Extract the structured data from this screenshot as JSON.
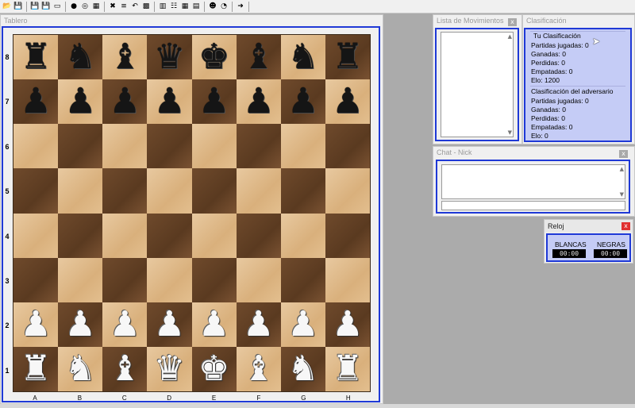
{
  "toolbar": {
    "icons": [
      "open-folder-icon",
      "save-icon",
      "save-as-icon",
      "save-all-icon",
      "board-icon",
      "globe-icon",
      "network-icon",
      "grid-icon",
      "close-x-icon",
      "stack-icon",
      "undo-icon",
      "pattern-icon",
      "bars-icon",
      "list-icon",
      "checker-icon",
      "book-icon",
      "chat-icon",
      "clock-icon",
      "exit-icon"
    ],
    "glyphs": [
      "📂",
      "💾",
      "💾",
      "💾",
      "▭",
      "●",
      "◎",
      "▦",
      "✖",
      "≡",
      "↶",
      "▩",
      "▥",
      "☷",
      "▦",
      "▤",
      "☻",
      "◔",
      "➜"
    ]
  },
  "tablero": {
    "title": "Tablero",
    "ranks": [
      "8",
      "7",
      "6",
      "5",
      "4",
      "3",
      "2",
      "1"
    ],
    "files": [
      "A",
      "B",
      "C",
      "D",
      "E",
      "F",
      "G",
      "H"
    ],
    "rows": [
      [
        "♜",
        "♞",
        "♝",
        "♛",
        "♚",
        "♝",
        "♞",
        "♜"
      ],
      [
        "♟",
        "♟",
        "♟",
        "♟",
        "♟",
        "♟",
        "♟",
        "♟"
      ],
      [
        "",
        "",
        "",
        "",
        "",
        "",
        "",
        ""
      ],
      [
        "",
        "",
        "",
        "",
        "",
        "",
        "",
        ""
      ],
      [
        "",
        "",
        "",
        "",
        "",
        "",
        "",
        ""
      ],
      [
        "",
        "",
        "",
        "",
        "",
        "",
        "",
        ""
      ],
      [
        "♟",
        "♟",
        "♟",
        "♟",
        "♟",
        "♟",
        "♟",
        "♟"
      ],
      [
        "♜",
        "♞",
        "♝",
        "♛",
        "♚",
        "♝",
        "♞",
        "♜"
      ]
    ],
    "colors": [
      "b",
      "b",
      "",
      "",
      "",
      "",
      "w",
      "w"
    ]
  },
  "movimientos": {
    "title": "Lista de Movimientos",
    "close": "x"
  },
  "clasificacion": {
    "title": "Clasificación",
    "tu": {
      "heading": "Tu Clasificación",
      "lines": [
        "Partidas jugadas: 0",
        "Ganadas: 0",
        "Perdidas: 0",
        "Empatadas: 0",
        "Elo: 1200"
      ]
    },
    "adversario": {
      "heading": "Clasificación del adversario",
      "lines": [
        "Partidas jugadas: 0",
        "Ganadas: 0",
        "Perdidas: 0",
        "Empatadas: 0",
        "Elo: 0"
      ]
    }
  },
  "chat": {
    "title": "Chat - Nick",
    "close": "x"
  },
  "reloj": {
    "title": "Reloj",
    "close": "x",
    "blancas_label": "BLANCAS",
    "negras_label": "NEGRAS",
    "blancas_time": "00:00",
    "negras_time": "00:00"
  },
  "colors": {
    "accent": "#1f39d6",
    "panel_bg": "#c5ccf6",
    "clock_close": "#e03030"
  }
}
